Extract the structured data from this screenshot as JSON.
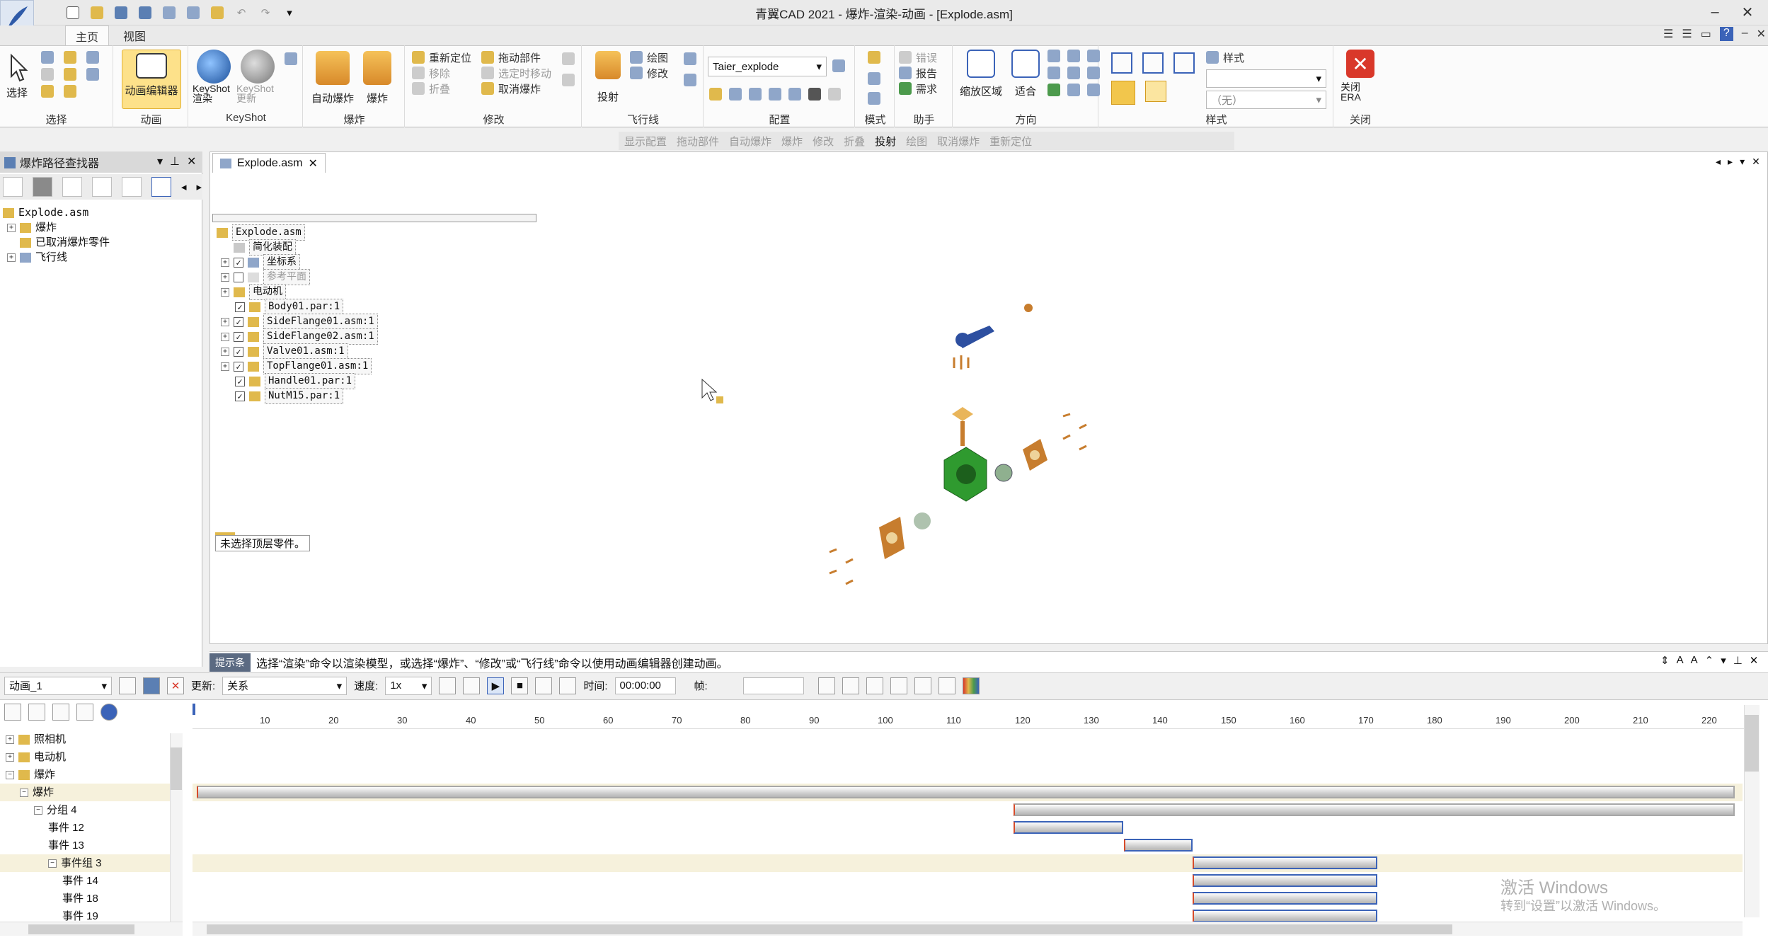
{
  "window": {
    "title": "青翼CAD 2021 - 爆炸-渲染-动画 - [Explode.asm]"
  },
  "menu_tabs": [
    "主页",
    "视图"
  ],
  "ribbon": {
    "select": {
      "label": "选择",
      "group": "选择"
    },
    "animation": {
      "label": "动画编辑器",
      "group": "动画"
    },
    "keyshot": {
      "btn1": "KeyShot 渲染",
      "btn2": "KeyShot 更新",
      "group": "KeyShot"
    },
    "explode": {
      "auto": "自动爆炸",
      "explode": "爆炸",
      "group": "爆炸"
    },
    "modify": {
      "items": [
        "重新定位",
        "移除",
        "折叠",
        "拖动部件",
        "选定时移动",
        "取消爆炸"
      ],
      "group": "修改"
    },
    "flyline": {
      "project": "投射",
      "draw": "绘图",
      "modify": "修改",
      "group": "飞行线"
    },
    "config": {
      "combo_value": "Taier_explode",
      "group": "配置"
    },
    "mode": {
      "group": "模式"
    },
    "assistant": {
      "items": [
        "错误",
        "报告",
        "需求"
      ],
      "group": "助手"
    },
    "direction": {
      "zoom": "缩放区域",
      "fit": "适合",
      "group": "方向"
    },
    "style": {
      "label": "样式",
      "combo_value": "（无）",
      "group": "样式"
    },
    "close": {
      "label": "关闭 ERA",
      "group": "关闭"
    }
  },
  "command_bar": [
    "显示配置",
    "拖动部件",
    "自动爆炸",
    "爆炸",
    "修改",
    "折叠",
    "投射",
    "绘图",
    "取消爆炸",
    "重新定位"
  ],
  "left_panel": {
    "title": "爆炸路径查找器",
    "tree": [
      {
        "indent": 0,
        "label": "Explode.asm"
      },
      {
        "indent": 1,
        "label": "爆炸"
      },
      {
        "indent": 1,
        "label": "已取消爆炸零件"
      },
      {
        "indent": 1,
        "label": "飞行线"
      }
    ]
  },
  "document": {
    "tab": "Explode.asm",
    "tree": [
      {
        "label": "Explode.asm",
        "check": null,
        "expander": false,
        "indent": 0
      },
      {
        "label": "简化装配",
        "check": null,
        "expander": false,
        "indent": 1
      },
      {
        "label": "坐标系",
        "check": true,
        "expander": true,
        "indent": 1
      },
      {
        "label": "参考平面",
        "check": false,
        "expander": true,
        "indent": 1
      },
      {
        "label": "电动机",
        "check": null,
        "expander": true,
        "indent": 1
      },
      {
        "label": "Body01.par:1",
        "check": true,
        "expander": false,
        "indent": 1
      },
      {
        "label": "SideFlange01.asm:1",
        "check": true,
        "expander": true,
        "indent": 1
      },
      {
        "label": "SideFlange02.asm:1",
        "check": true,
        "expander": true,
        "indent": 1
      },
      {
        "label": "Valve01.asm:1",
        "check": true,
        "expander": true,
        "indent": 1
      },
      {
        "label": "TopFlange01.asm:1",
        "check": true,
        "expander": true,
        "indent": 1
      },
      {
        "label": "Handle01.par:1",
        "check": true,
        "expander": false,
        "indent": 1
      },
      {
        "label": "NutM15.par:1",
        "check": true,
        "expander": false,
        "indent": 1
      }
    ],
    "status_note": "未选择顶层零件。"
  },
  "hint": {
    "tag": "提示条",
    "text": "选择“渲染”命令以渲染模型，或选择“爆炸”、“修改”或“飞行线”命令以使用动画编辑器创建动画。"
  },
  "animation": {
    "name": "动画_1",
    "update_label": "更新:",
    "update_value": "关系",
    "speed_label": "速度:",
    "speed_value": "1x",
    "time_label": "时间:",
    "time_value": "00:00:00",
    "frame_label": "帧:",
    "frame_value": ""
  },
  "timeline": {
    "ticks": [
      10,
      20,
      30,
      40,
      50,
      60,
      70,
      80,
      90,
      100,
      110,
      120,
      130,
      140,
      150,
      160,
      170,
      180,
      190,
      200,
      210,
      220
    ],
    "tree": [
      {
        "indent": 0,
        "label": "照相机",
        "expander": "+"
      },
      {
        "indent": 0,
        "label": "电动机",
        "expander": "+"
      },
      {
        "indent": 0,
        "label": "爆炸",
        "expander": "−"
      },
      {
        "indent": 1,
        "label": "爆炸",
        "expander": "−"
      },
      {
        "indent": 2,
        "label": "分组 4",
        "expander": "−"
      },
      {
        "indent": 3,
        "label": "事件 12",
        "expander": ""
      },
      {
        "indent": 3,
        "label": "事件 13",
        "expander": ""
      },
      {
        "indent": 3,
        "label": "事件组 3",
        "expander": "−"
      },
      {
        "indent": 4,
        "label": "事件 14",
        "expander": ""
      },
      {
        "indent": 4,
        "label": "事件 18",
        "expander": ""
      },
      {
        "indent": 4,
        "label": "事件 19",
        "expander": ""
      }
    ],
    "bars": [
      {
        "row": 3,
        "start": 0,
        "end": 224
      },
      {
        "row": 4,
        "start": 119,
        "end": 224
      },
      {
        "row": 5,
        "start": 119,
        "end": 135
      },
      {
        "row": 6,
        "start": 135,
        "end": 145
      },
      {
        "row": 7,
        "start": 145,
        "end": 172
      },
      {
        "row": 8,
        "start": 145,
        "end": 172
      },
      {
        "row": 9,
        "start": 145,
        "end": 172
      },
      {
        "row": 10,
        "start": 145,
        "end": 172
      }
    ]
  },
  "watermark": {
    "line1": "激活 Windows",
    "line2": "转到“设置”以激活 Windows。"
  }
}
